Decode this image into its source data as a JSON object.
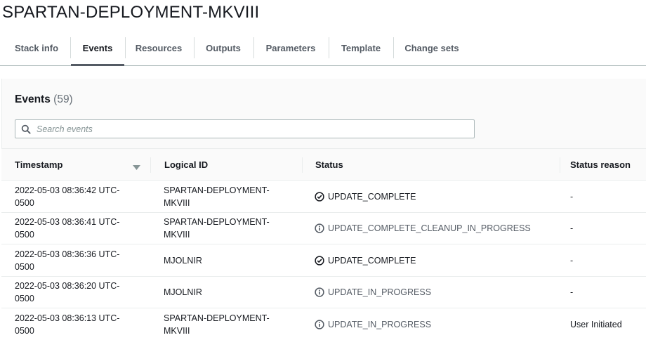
{
  "stack": {
    "title": "SPARTAN-DEPLOYMENT-MKVIII"
  },
  "tabs": [
    {
      "label": "Stack info",
      "active": false
    },
    {
      "label": "Events",
      "active": true
    },
    {
      "label": "Resources",
      "active": false
    },
    {
      "label": "Outputs",
      "active": false
    },
    {
      "label": "Parameters",
      "active": false
    },
    {
      "label": "Template",
      "active": false
    },
    {
      "label": "Change sets",
      "active": false
    }
  ],
  "events": {
    "heading": "Events",
    "count": "(59)",
    "search": {
      "placeholder": "Search events",
      "value": ""
    },
    "columns": {
      "timestamp": "Timestamp",
      "logical_id": "Logical ID",
      "status": "Status",
      "status_reason": "Status reason"
    },
    "rows": [
      {
        "ts_line1": "2022-05-03 08:36:42 UTC-",
        "ts_line2": "0500",
        "lid_line1": "SPARTAN-DEPLOYMENT-",
        "lid_line2": "MKVIII",
        "status": "UPDATE_COMPLETE",
        "status_icon": "check-circle-icon",
        "reason": "-"
      },
      {
        "ts_line1": "2022-05-03 08:36:41 UTC-",
        "ts_line2": "0500",
        "lid_line1": "SPARTAN-DEPLOYMENT-",
        "lid_line2": "MKVIII",
        "status": "UPDATE_COMPLETE_CLEANUP_IN_PROGRESS",
        "status_icon": "info-circle-icon",
        "reason": "-"
      },
      {
        "ts_line1": "2022-05-03 08:36:36 UTC-",
        "ts_line2": "0500",
        "lid_line1": "MJOLNIR",
        "lid_line2": "",
        "status": "UPDATE_COMPLETE",
        "status_icon": "check-circle-icon",
        "reason": "-"
      },
      {
        "ts_line1": "2022-05-03 08:36:20 UTC-",
        "ts_line2": "0500",
        "lid_line1": "MJOLNIR",
        "lid_line2": "",
        "status": "UPDATE_IN_PROGRESS",
        "status_icon": "info-circle-icon",
        "reason": "-"
      },
      {
        "ts_line1": "2022-05-03 08:36:13 UTC-",
        "ts_line2": "0500",
        "lid_line1": "SPARTAN-DEPLOYMENT-",
        "lid_line2": "MKVIII",
        "status": "UPDATE_IN_PROGRESS",
        "status_icon": "info-circle-icon",
        "reason": "User Initiated"
      }
    ]
  },
  "colors": {
    "tab_indicator": "#545b64",
    "text": "#16191f",
    "muted": "#687078",
    "border": "#eaeded"
  }
}
